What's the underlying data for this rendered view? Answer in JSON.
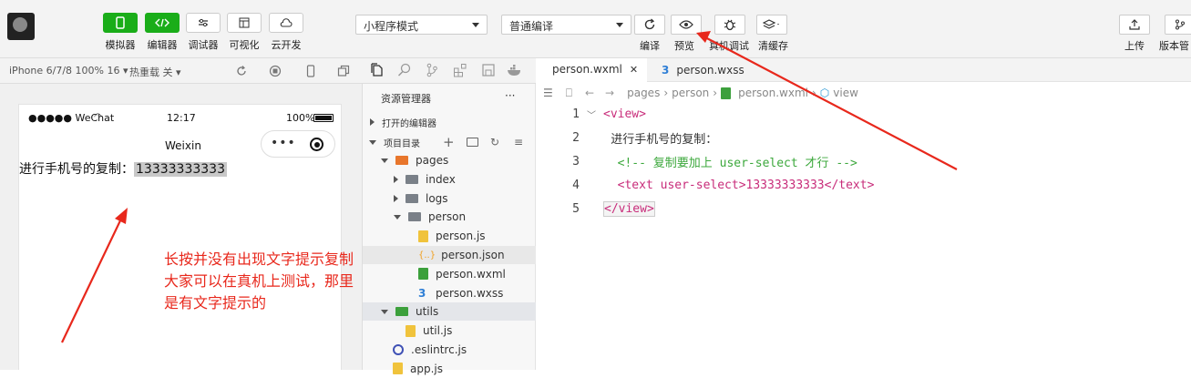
{
  "toolbar": {
    "left_buttons": [
      {
        "label": "模拟器",
        "active": true
      },
      {
        "label": "编辑器",
        "active": true
      },
      {
        "label": "调试器",
        "active": false
      },
      {
        "label": "可视化",
        "active": false
      },
      {
        "label": "云开发",
        "active": false
      }
    ],
    "mode_select": "小程序模式",
    "compile_select": "普通编译",
    "actions": [
      "编译",
      "预览",
      "真机调试",
      "清缓存"
    ],
    "right_actions": [
      "上传",
      "版本管"
    ]
  },
  "simbar": {
    "device": "iPhone 6/7/8 100% 16",
    "hot_reload": "热重载 关"
  },
  "phone": {
    "signal": "●●●●● WeChat",
    "time": "12:17",
    "battery": "100%",
    "nav_title": "Weixin",
    "content_label": "进行手机号的复制：",
    "content_number": "13333333333"
  },
  "annotation": {
    "line1": "长按并没有出现文字提示复制",
    "line2": "大家可以在真机上测试，那里",
    "line3": "是有文字提示的"
  },
  "explorer": {
    "title": "资源管理器",
    "more": "···",
    "open_editors": "打开的编辑器",
    "project_dir": "项目目录",
    "tree": [
      {
        "name": "pages",
        "kind": "folder-open",
        "indent": 1,
        "color": "#e8762c"
      },
      {
        "name": "index",
        "kind": "folder",
        "indent": 2,
        "color": "#7a8088"
      },
      {
        "name": "logs",
        "kind": "folder",
        "indent": 2,
        "color": "#7a8088"
      },
      {
        "name": "person",
        "kind": "folder-open",
        "indent": 2,
        "color": "#7a8088"
      },
      {
        "name": "person.js",
        "kind": "js",
        "indent": 3,
        "color": "#f0c33c"
      },
      {
        "name": "person.json",
        "kind": "json",
        "indent": 3,
        "color": "#f0a020"
      },
      {
        "name": "person.wxml",
        "kind": "wxml",
        "indent": 3,
        "color": "#3ca03c"
      },
      {
        "name": "person.wxss",
        "kind": "wxss",
        "indent": 3,
        "color": "#2f7fd6"
      },
      {
        "name": "utils",
        "kind": "folder-open",
        "indent": 1,
        "color": "#3ca03c"
      },
      {
        "name": "util.js",
        "kind": "js",
        "indent": 2,
        "color": "#f0c33c"
      },
      {
        "name": ".eslintrc.js",
        "kind": "eslint",
        "indent": 1,
        "color": "#3f51b5"
      },
      {
        "name": "app.js",
        "kind": "js",
        "indent": 1,
        "color": "#f0c33c"
      }
    ]
  },
  "editor": {
    "tabs": [
      {
        "name": "person.wxml",
        "close": "✕"
      },
      {
        "name": "person.wxss"
      }
    ],
    "breadcrumb": [
      "pages",
      "person",
      "person.wxml",
      "view"
    ],
    "lines": [
      {
        "num": "1",
        "text": "<view>"
      },
      {
        "num": "2",
        "text": "  进行手机号的复制："
      },
      {
        "num": "3",
        "text": "  <!-- 复制要加上 user-select 才行 -->"
      },
      {
        "num": "4",
        "text": "  <text user-select>13333333333</text>"
      },
      {
        "num": "5",
        "text": "</view>"
      }
    ]
  },
  "colors": {
    "accent_green": "#1aad19",
    "annotation_red": "#e8281c",
    "tag_color": "#c82c7a",
    "comment_color": "#3ca83c"
  }
}
